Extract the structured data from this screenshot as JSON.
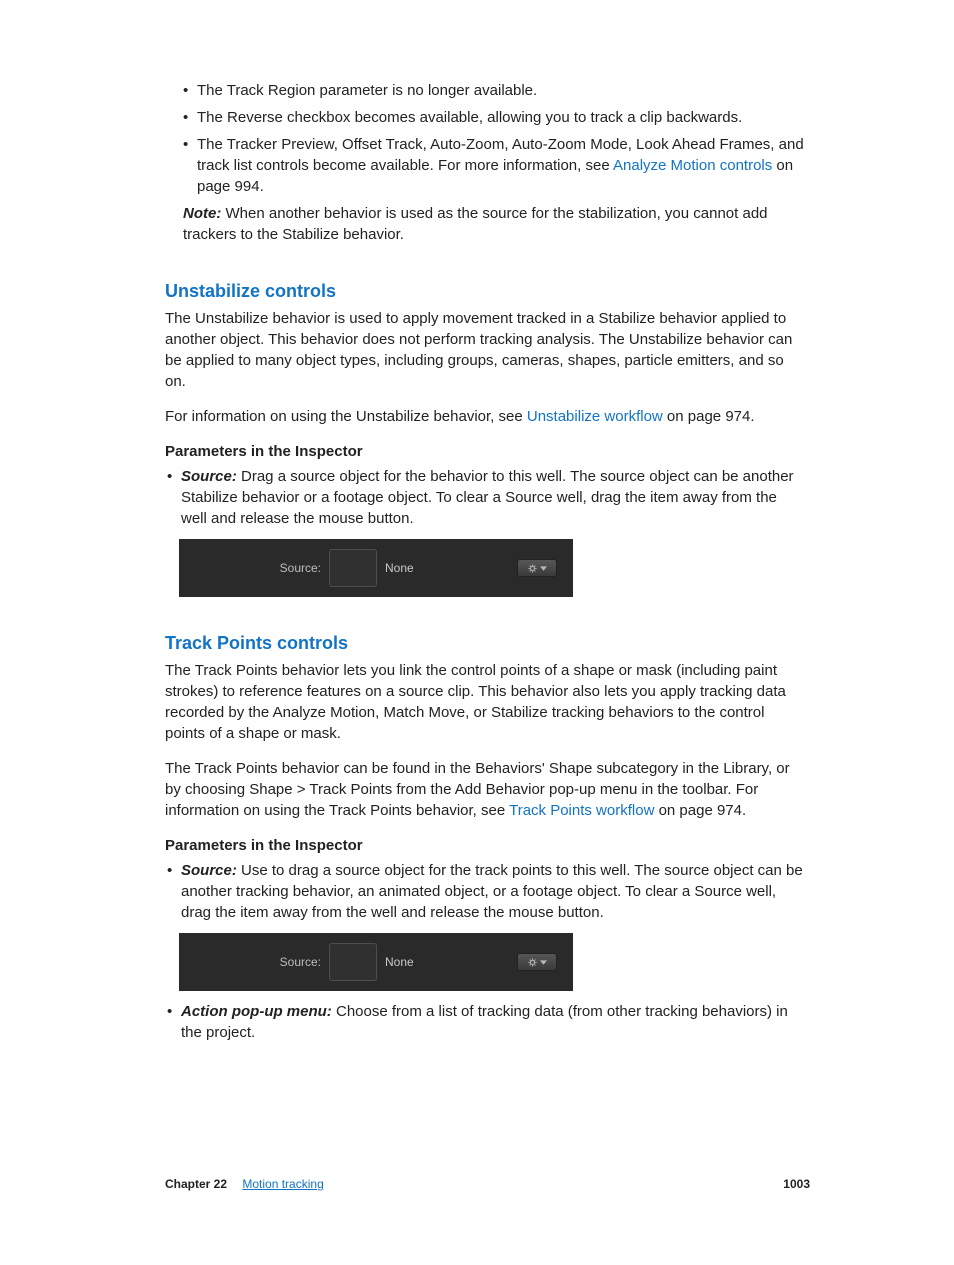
{
  "top_bullets": [
    "The Track Region parameter is no longer available.",
    "The Reverse checkbox becomes available, allowing you to track a clip backwards."
  ],
  "top_bullet3_a": "The Tracker Preview, Offset Track, Auto-Zoom, Auto-Zoom Mode, Look Ahead Frames, and track list controls become available. For more information, see ",
  "top_bullet3_link": "Analyze Motion controls",
  "top_bullet3_b": " on page 994.",
  "note_label": "Note:  ",
  "note_text": "When another behavior is used as the source for the stabilization, you cannot add trackers to the Stabilize behavior.",
  "unstabilize": {
    "title": "Unstabilize controls",
    "p1": "The Unstabilize behavior is used to apply movement tracked in a Stabilize behavior applied to another object. This behavior does not perform tracking analysis. The Unstabilize behavior can be applied to many object types, including groups, cameras, shapes, particle emitters, and so on.",
    "p2_a": "For information on using the Unstabilize behavior, see ",
    "p2_link": "Unstabilize workflow",
    "p2_b": " on page 974.",
    "params_heading": "Parameters in the Inspector",
    "source_label": "Source: ",
    "source_text": "Drag a source object for the behavior to this well. The source object can be another Stabilize behavior or a footage object. To clear a Source well, drag the item away from the well and release the mouse button."
  },
  "inspector1": {
    "label": "Source:",
    "value": "None"
  },
  "trackpoints": {
    "title": "Track Points controls",
    "p1": "The Track Points behavior lets you link the control points of a shape or mask (including paint strokes) to reference features on a source clip. This behavior also lets you apply tracking data recorded by the Analyze Motion, Match Move, or Stabilize tracking behaviors to the control points of a shape or mask.",
    "p2_a": "The Track Points behavior can be found in the Behaviors' Shape subcategory in the Library, or by choosing Shape > Track Points from the Add Behavior pop-up menu in the toolbar. For information on using the Track Points behavior, see ",
    "p2_link": "Track Points workflow",
    "p2_b": " on page 974.",
    "params_heading": "Parameters in the Inspector",
    "source_label": "Source: ",
    "source_text": "Use to drag a source object for the track points to this well. The source object can be another tracking behavior, an animated object, or a footage object. To clear a Source well, drag the item away from the well and release the mouse button.",
    "action_label": "Action pop-up menu: ",
    "action_text": "Choose from a list of tracking data (from other tracking behaviors) in the project."
  },
  "inspector2": {
    "label": "Source:",
    "value": "None"
  },
  "footer": {
    "chapter": "Chapter 22",
    "chapter_title": "Motion tracking",
    "page": "1003"
  }
}
